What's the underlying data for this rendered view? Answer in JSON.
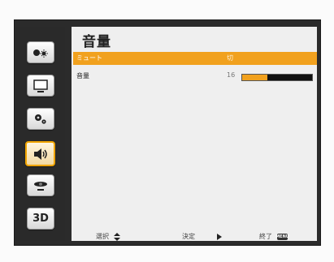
{
  "menu": {
    "title": "音量",
    "items": [
      {
        "label": "ミュート",
        "value": "切",
        "highlighted": true
      },
      {
        "label": "音量",
        "value": "16",
        "level_fraction": 0.36
      }
    ]
  },
  "tabs": [
    {
      "icon": "brightness-icon",
      "selected": false
    },
    {
      "icon": "display-icon",
      "selected": false
    },
    {
      "icon": "settings-icon",
      "selected": false
    },
    {
      "icon": "speaker-icon",
      "selected": true
    },
    {
      "icon": "projector-icon",
      "selected": false
    },
    {
      "icon": "3d-icon",
      "label": "3D",
      "selected": false
    }
  ],
  "footer": {
    "select_label": "選択",
    "enter_label": "決定",
    "exit_label": "終了",
    "menu_button_label": "MENU"
  },
  "colors": {
    "accent": "#f1a11e",
    "panel": "#efefef",
    "sidebar": "#2a2a2a"
  }
}
